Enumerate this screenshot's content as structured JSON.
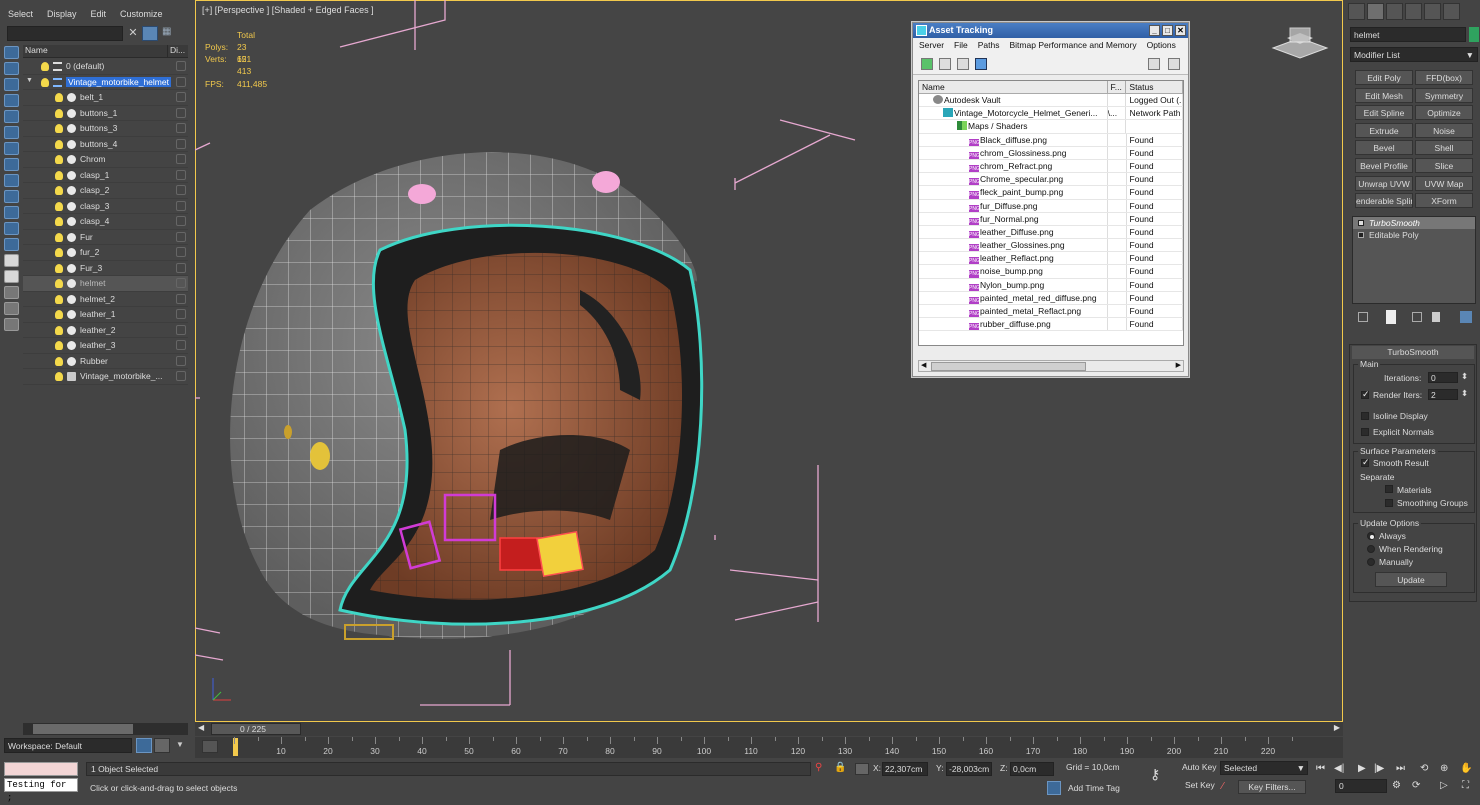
{
  "explorer": {
    "menu": [
      "Select",
      "Display",
      "Edit",
      "Customize"
    ],
    "columns": {
      "name": "Name",
      "disp": "Di..."
    },
    "items": [
      {
        "label": "0 (default)",
        "kind": "layer",
        "indent": 1
      },
      {
        "label": "Vintage_motorbike_helmet",
        "kind": "layer",
        "indent": 1,
        "selected": true
      },
      {
        "label": "belt_1",
        "kind": "obj",
        "indent": 2
      },
      {
        "label": "buttons_1",
        "kind": "obj",
        "indent": 2
      },
      {
        "label": "buttons_3",
        "kind": "obj",
        "indent": 2
      },
      {
        "label": "buttons_4",
        "kind": "obj",
        "indent": 2
      },
      {
        "label": "Chrom",
        "kind": "obj",
        "indent": 2
      },
      {
        "label": "clasp_1",
        "kind": "obj",
        "indent": 2
      },
      {
        "label": "clasp_2",
        "kind": "obj",
        "indent": 2
      },
      {
        "label": "clasp_3",
        "kind": "obj",
        "indent": 2
      },
      {
        "label": "clasp_4",
        "kind": "obj",
        "indent": 2
      },
      {
        "label": "Fur",
        "kind": "obj",
        "indent": 2
      },
      {
        "label": "fur_2",
        "kind": "obj",
        "indent": 2
      },
      {
        "label": "Fur_3",
        "kind": "obj",
        "indent": 2
      },
      {
        "label": "helmet",
        "kind": "obj",
        "indent": 2,
        "highlight": true
      },
      {
        "label": "helmet_2",
        "kind": "obj",
        "indent": 2
      },
      {
        "label": "leather_1",
        "kind": "obj",
        "indent": 2
      },
      {
        "label": "leather_2",
        "kind": "obj",
        "indent": 2
      },
      {
        "label": "leather_3",
        "kind": "obj",
        "indent": 2
      },
      {
        "label": "Rubber",
        "kind": "obj",
        "indent": 2
      },
      {
        "label": "Vintage_motorbike_...",
        "kind": "group",
        "indent": 2
      }
    ],
    "workspace": "Workspace: Default"
  },
  "viewport": {
    "label": "[+] [Perspective ] [Shaded + Edged Faces ]",
    "stats": {
      "total": "Total",
      "polys_label": "Polys:",
      "polys": "23 651",
      "verts_label": "Verts:",
      "verts": "12 413",
      "fps_label": "FPS:",
      "fps": "411,485"
    }
  },
  "asset": {
    "title": "Asset Tracking",
    "menu": [
      "Server",
      "File",
      "Paths",
      "Bitmap Performance and Memory",
      "Options"
    ],
    "columns": {
      "name": "Name",
      "f": "F...",
      "status": "Status"
    },
    "rows": [
      {
        "name": "Autodesk Vault",
        "f": "",
        "status": "Logged Out (...",
        "icon": "vault",
        "indent": 14
      },
      {
        "name": "Vintage_Motorcycle_Helmet_Generi...",
        "f": "\\...",
        "status": "Network Path",
        "icon": "max",
        "indent": 24
      },
      {
        "name": "Maps / Shaders",
        "f": "",
        "status": "",
        "icon": "maps",
        "indent": 38
      },
      {
        "name": "Black_diffuse.png",
        "f": "",
        "status": "Found",
        "icon": "png",
        "indent": 50
      },
      {
        "name": "chrom_Glossiness.png",
        "f": "",
        "status": "Found",
        "icon": "png",
        "indent": 50
      },
      {
        "name": "chrom_Refract.png",
        "f": "",
        "status": "Found",
        "icon": "png",
        "indent": 50
      },
      {
        "name": "Chrome_specular.png",
        "f": "",
        "status": "Found",
        "icon": "png",
        "indent": 50
      },
      {
        "name": "fleck_paint_bump.png",
        "f": "",
        "status": "Found",
        "icon": "png",
        "indent": 50
      },
      {
        "name": "fur_Diffuse.png",
        "f": "",
        "status": "Found",
        "icon": "png",
        "indent": 50
      },
      {
        "name": "fur_Normal.png",
        "f": "",
        "status": "Found",
        "icon": "png",
        "indent": 50
      },
      {
        "name": "leather_Diffuse.png",
        "f": "",
        "status": "Found",
        "icon": "png",
        "indent": 50
      },
      {
        "name": "leather_Glossines.png",
        "f": "",
        "status": "Found",
        "icon": "png",
        "indent": 50
      },
      {
        "name": "leather_Reflact.png",
        "f": "",
        "status": "Found",
        "icon": "png",
        "indent": 50
      },
      {
        "name": "noise_bump.png",
        "f": "",
        "status": "Found",
        "icon": "png",
        "indent": 50
      },
      {
        "name": "Nylon_bump.png",
        "f": "",
        "status": "Found",
        "icon": "png",
        "indent": 50
      },
      {
        "name": "painted_metal_red_diffuse.png",
        "f": "",
        "status": "Found",
        "icon": "png",
        "indent": 50
      },
      {
        "name": "painted_metal_Reflact.png",
        "f": "",
        "status": "Found",
        "icon": "png",
        "indent": 50
      },
      {
        "name": "rubber_diffuse.png",
        "f": "",
        "status": "Found",
        "icon": "png",
        "indent": 50
      }
    ]
  },
  "command": {
    "name": "helmet",
    "modifier_list": "Modifier List",
    "buttons": [
      [
        "Edit Poly",
        "FFD(box)"
      ],
      [
        "Edit Mesh",
        "Symmetry"
      ],
      [
        "Edit Spline",
        "Optimize"
      ],
      [
        "Extrude",
        "Noise"
      ],
      [
        "Bevel",
        "Shell"
      ],
      [
        "Bevel Profile",
        "Slice"
      ],
      [
        "Unwrap UVW",
        "UVW Map"
      ],
      [
        "enderable Splin",
        "XForm"
      ]
    ],
    "stack": [
      "TurboSmooth",
      "Editable Poly"
    ],
    "turbosmooth": {
      "header": "TurboSmooth",
      "main": "Main",
      "iterations_label": "Iterations:",
      "iterations": "0",
      "render_iters_label": "Render Iters:",
      "render_iters": "2",
      "isoline": "Isoline Display",
      "explicit": "Explicit Normals",
      "surface": "Surface Parameters",
      "smooth_result": "Smooth Result",
      "separate": "Separate",
      "materials": "Materials",
      "smoothing_groups": "Smoothing Groups",
      "update_options": "Update Options",
      "always": "Always",
      "when_rendering": "When Rendering",
      "manually": "Manually",
      "update": "Update"
    }
  },
  "timeline": {
    "frame": "0 / 225",
    "ticks": [
      "10",
      "20",
      "30",
      "40",
      "50",
      "60",
      "70",
      "80",
      "90",
      "100",
      "110",
      "120",
      "130",
      "140",
      "150",
      "160",
      "170",
      "180",
      "190",
      "200",
      "210",
      "220"
    ]
  },
  "status": {
    "maxscript": "Testing for ;",
    "selected": "1 Object Selected",
    "prompt": "Click or click-and-drag to select objects",
    "x_label": "X:",
    "x": "22,307cm",
    "y_label": "Y:",
    "y": "-28,003cm",
    "z_label": "Z:",
    "z": "0,0cm",
    "grid": "Grid = 10,0cm",
    "add_time_tag": "Add Time Tag",
    "auto_key": "Auto Key",
    "set_key": "Set Key",
    "selected_dd": "Selected",
    "key_filters": "Key Filters...",
    "frame": "0"
  }
}
